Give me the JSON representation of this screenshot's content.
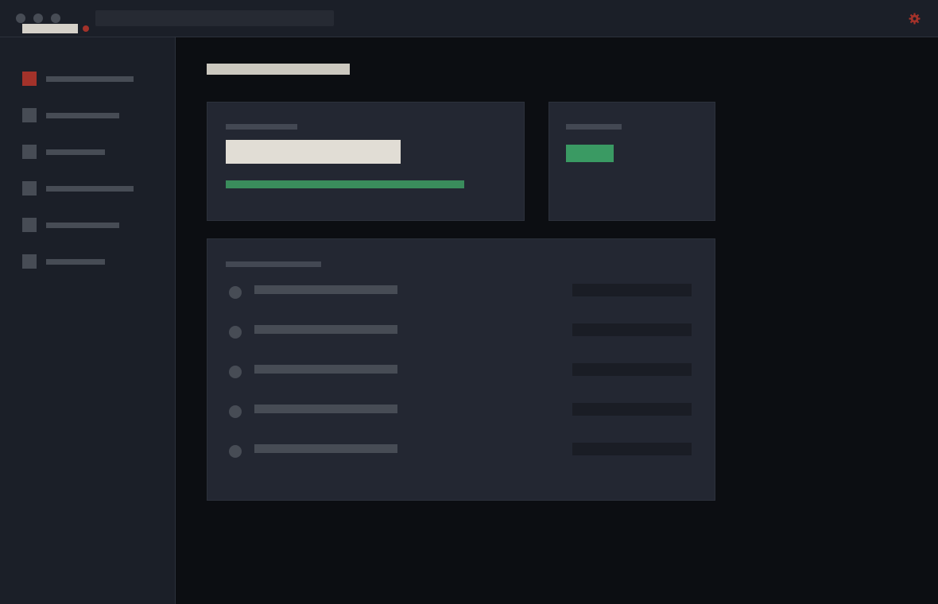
{
  "window": {
    "title": "",
    "address": ""
  },
  "colors": {
    "accent": "#a3322a",
    "success": "#3a9a63",
    "panel": "#232732",
    "chrome": "#1b1f28",
    "background": "#0c0e12"
  },
  "icons": {
    "settings": "gear-icon"
  },
  "sidebar": {
    "items": [
      {
        "label": "",
        "active": true
      },
      {
        "label": "",
        "active": false
      },
      {
        "label": "",
        "active": false
      },
      {
        "label": "",
        "active": false
      },
      {
        "label": "",
        "active": false
      },
      {
        "label": "",
        "active": false
      }
    ]
  },
  "main": {
    "title": "",
    "metric_card": {
      "label": "",
      "value": "",
      "progress": 1.0
    },
    "status_card": {
      "label": "",
      "status": ""
    },
    "list": {
      "title": "",
      "rows": [
        {
          "name": "",
          "value": ""
        },
        {
          "name": "",
          "value": ""
        },
        {
          "name": "",
          "value": ""
        },
        {
          "name": "",
          "value": ""
        },
        {
          "name": "",
          "value": ""
        }
      ]
    }
  }
}
